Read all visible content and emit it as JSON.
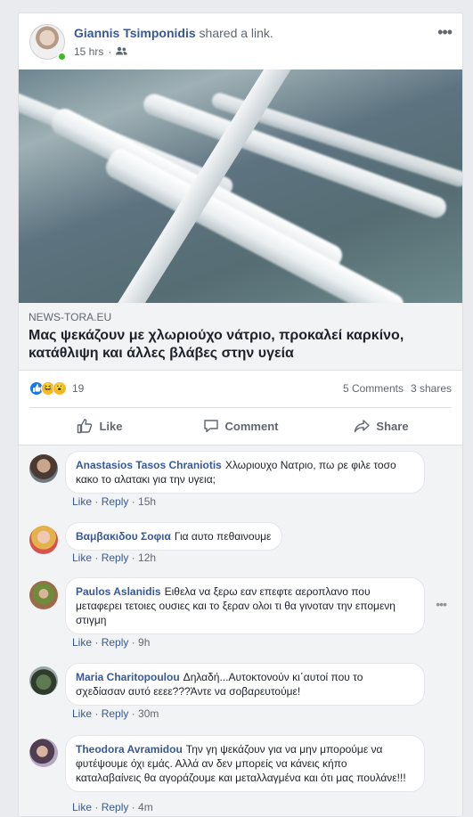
{
  "post": {
    "author": "Giannis Tsimponidis",
    "action_prefix": "shared a",
    "action_link": "link.",
    "time": "15 hrs",
    "separator": "·",
    "audience_icon": "friends-icon"
  },
  "link": {
    "domain": "NEWS-TORA.EU",
    "title": "Μας ψεκάζουν με χλωριούχο νάτριο, προκαλεί καρκίνο, κατάθλιψη και άλλες βλάβες στην υγεία"
  },
  "stats": {
    "reaction_icons": [
      "like-icon",
      "haha-icon",
      "wow-icon"
    ],
    "reaction_count": "19",
    "comments": "5 Comments",
    "shares": "3 shares"
  },
  "actions": {
    "like": "Like",
    "comment": "Comment",
    "share": "Share"
  },
  "comments": [
    {
      "name": "Anastasios Tasos Chraniotis",
      "text": "Χλωριουχο Νατριο, πω ρε φιλε τοσο κακο το αλατακι για την υγεια;",
      "like": "Like",
      "reply": "Reply",
      "time": "15h"
    },
    {
      "name": "Βαμβακιδου Σοφια",
      "text": "Για αυτο πεθαινουμε",
      "like": "Like",
      "reply": "Reply",
      "time": "12h"
    },
    {
      "name": "Paulos Aslanidis",
      "text": "Ειθελα να ξερω εαν επεφτε αεροπλανο που μεταφερει τετοιες ουσιες και το ξεραν ολοι τι θα γινοταν την επομενη στιγμη",
      "like": "Like",
      "reply": "Reply",
      "time": "9h"
    },
    {
      "name": "Maria Charitopoulou",
      "text": "Δηλαδή...Αυτοκτονούν κι΄αυτοί που το σχεδίασαν αυτό εεεε???Άντε να σοβαρευτούμε!",
      "like": "Like",
      "reply": "Reply",
      "time": "30m"
    },
    {
      "name": "Theodora Avramidou",
      "text": "Την γη ψεκάζουν για να μην μπορούμε να φυτέψουμε όχι εμάς. Αλλά αν δεν μπορείς να κάνεις κήπο καταλαβαίνεις θα αγοράζουμε και μεταλλαγμένα και ότι μας πουλάνε!!!",
      "like": "Like",
      "reply": "Reply",
      "time": "4m"
    }
  ],
  "colors": {
    "link_blue": "#385898",
    "meta_gray": "#606770",
    "like_blue": "#1877f2",
    "online_green": "#42b72a"
  }
}
